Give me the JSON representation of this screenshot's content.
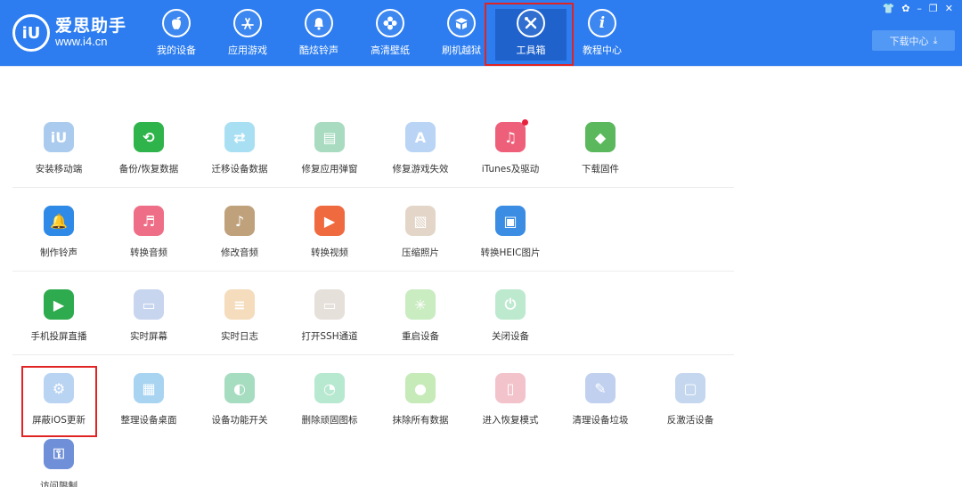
{
  "app": {
    "logo_text": "爱思助手",
    "logo_url": "www.i4.cn",
    "logo_mark": "iU"
  },
  "nav": {
    "items": [
      {
        "label": "我的设备",
        "icon": "apple-icon"
      },
      {
        "label": "应用游戏",
        "icon": "app-store-icon"
      },
      {
        "label": "酷炫铃声",
        "icon": "bell-icon"
      },
      {
        "label": "高清壁纸",
        "icon": "flower-icon"
      },
      {
        "label": "刷机越狱",
        "icon": "box-icon"
      },
      {
        "label": "工具箱",
        "icon": "tools-icon"
      },
      {
        "label": "教程中心",
        "icon": "info-icon"
      }
    ],
    "active": "工具箱"
  },
  "window_controls": {
    "shirt": "shirt-icon",
    "settings": "gear-icon",
    "minimize": "minimize-icon",
    "restore": "restore-icon",
    "close": "close-icon"
  },
  "download": {
    "label": "下载中心",
    "icon": "download-arrow-icon"
  },
  "tools": [
    {
      "label": "安装移动端",
      "icon": "iu-app-icon",
      "color": "#aacbee"
    },
    {
      "label": "备份/恢复数据",
      "icon": "backup-clock-icon",
      "color": "#2eb44a"
    },
    {
      "label": "迁移设备数据",
      "icon": "phone-transfer-icon",
      "color": "#a9dff3"
    },
    {
      "label": "修复应用弹窗",
      "icon": "window-fix-icon",
      "color": "#a8dbc0"
    },
    {
      "label": "修复游戏失效",
      "icon": "app-store-fix-icon",
      "color": "#b9d4f5"
    },
    {
      "label": "iTunes及驱动",
      "icon": "itunes-icon",
      "color": "#ee5f7a",
      "badge": true
    },
    {
      "label": "下载固件",
      "icon": "cube-icon",
      "color": "#5cb85c"
    },
    {
      "label": "制作铃声",
      "icon": "bell-make-icon",
      "color": "#2e8ae6"
    },
    {
      "label": "转换音频",
      "icon": "audio-convert-icon",
      "color": "#ef6e87"
    },
    {
      "label": "修改音频",
      "icon": "audio-edit-icon",
      "color": "#bfa27c"
    },
    {
      "label": "转换视频",
      "icon": "video-convert-icon",
      "color": "#f06a3f"
    },
    {
      "label": "压缩照片",
      "icon": "photo-compress-icon",
      "color": "#e3d6c9"
    },
    {
      "label": "转换HEIC图片",
      "icon": "heic-convert-icon",
      "color": "#3a8de3"
    },
    {
      "label": "手机投屏直播",
      "icon": "screen-cast-icon",
      "color": "#2eab4e"
    },
    {
      "label": "实时屏幕",
      "icon": "monitor-icon",
      "color": "#c8d5ef"
    },
    {
      "label": "实时日志",
      "icon": "log-icon",
      "color": "#f5dcbc"
    },
    {
      "label": "打开SSH通道",
      "icon": "ssh-icon",
      "color": "#e6e0db"
    },
    {
      "label": "重启设备",
      "icon": "restart-icon",
      "color": "#c9ecc1"
    },
    {
      "label": "关闭设备",
      "icon": "power-icon",
      "color": "#bde9cf"
    },
    {
      "label": "屏蔽iOS更新",
      "icon": "block-update-gear-icon",
      "color": "#b9d3f2"
    },
    {
      "label": "整理设备桌面",
      "icon": "grid-icon",
      "color": "#a8d4f2"
    },
    {
      "label": "设备功能开关",
      "icon": "toggle-icon",
      "color": "#a6dcc0"
    },
    {
      "label": "删除顽固图标",
      "icon": "pie-icon",
      "color": "#b7e8d0"
    },
    {
      "label": "抹除所有数据",
      "icon": "erase-apple-icon",
      "color": "#c6eab8"
    },
    {
      "label": "进入恢复模式",
      "icon": "recovery-phone-icon",
      "color": "#f3c3cb"
    },
    {
      "label": "清理设备垃圾",
      "icon": "broom-icon",
      "color": "#c0d0ee"
    },
    {
      "label": "反激活设备",
      "icon": "deactivate-icon",
      "color": "#c4d7ee"
    },
    {
      "label": "访问限制",
      "icon": "lock-keyhole-icon",
      "color": "#6f8fd8"
    }
  ]
}
